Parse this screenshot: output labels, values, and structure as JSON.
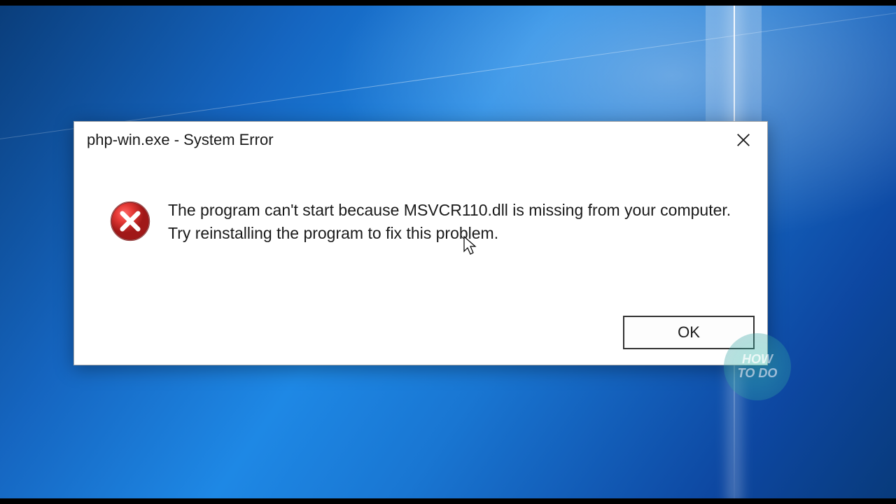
{
  "dialog": {
    "title": "php-win.exe - System Error",
    "message": "The program can't start because MSVCR110.dll is missing from your computer. Try reinstalling the program to fix this problem.",
    "ok_label": "OK"
  },
  "watermark": {
    "line1": "HOW",
    "line2": "TO DO"
  }
}
